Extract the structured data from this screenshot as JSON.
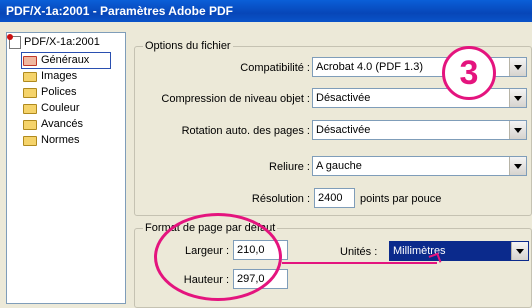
{
  "window": {
    "title": "PDF/X-1a:2001 - Paramètres Adobe PDF"
  },
  "tree": {
    "root": "PDF/X-1a:2001",
    "items": [
      {
        "label": "Généraux",
        "selected": true
      },
      {
        "label": "Images"
      },
      {
        "label": "Polices"
      },
      {
        "label": "Couleur"
      },
      {
        "label": "Avancés"
      },
      {
        "label": "Normes"
      }
    ]
  },
  "options_fichier": {
    "title": "Options du fichier",
    "compatibilite": {
      "label": "Compatibilité :",
      "value": "Acrobat 4.0 (PDF 1.3)"
    },
    "compression": {
      "label": "Compression de niveau objet :",
      "value": "Désactivée"
    },
    "rotation": {
      "label": "Rotation auto. des pages :",
      "value": "Désactivée"
    },
    "reliure": {
      "label": "Reliure :",
      "value": "A gauche"
    },
    "resolution": {
      "label": "Résolution :",
      "value": "2400",
      "unit": "points par pouce"
    }
  },
  "format_page": {
    "title": "Format de page par défaut",
    "largeur": {
      "label": "Largeur :",
      "value": "210,0"
    },
    "hauteur": {
      "label": "Hauteur :",
      "value": "297,0"
    },
    "unites": {
      "label": "Unités :",
      "value": "Millimètres"
    }
  },
  "annotation": {
    "number": "3",
    "color": "#e4147e"
  }
}
